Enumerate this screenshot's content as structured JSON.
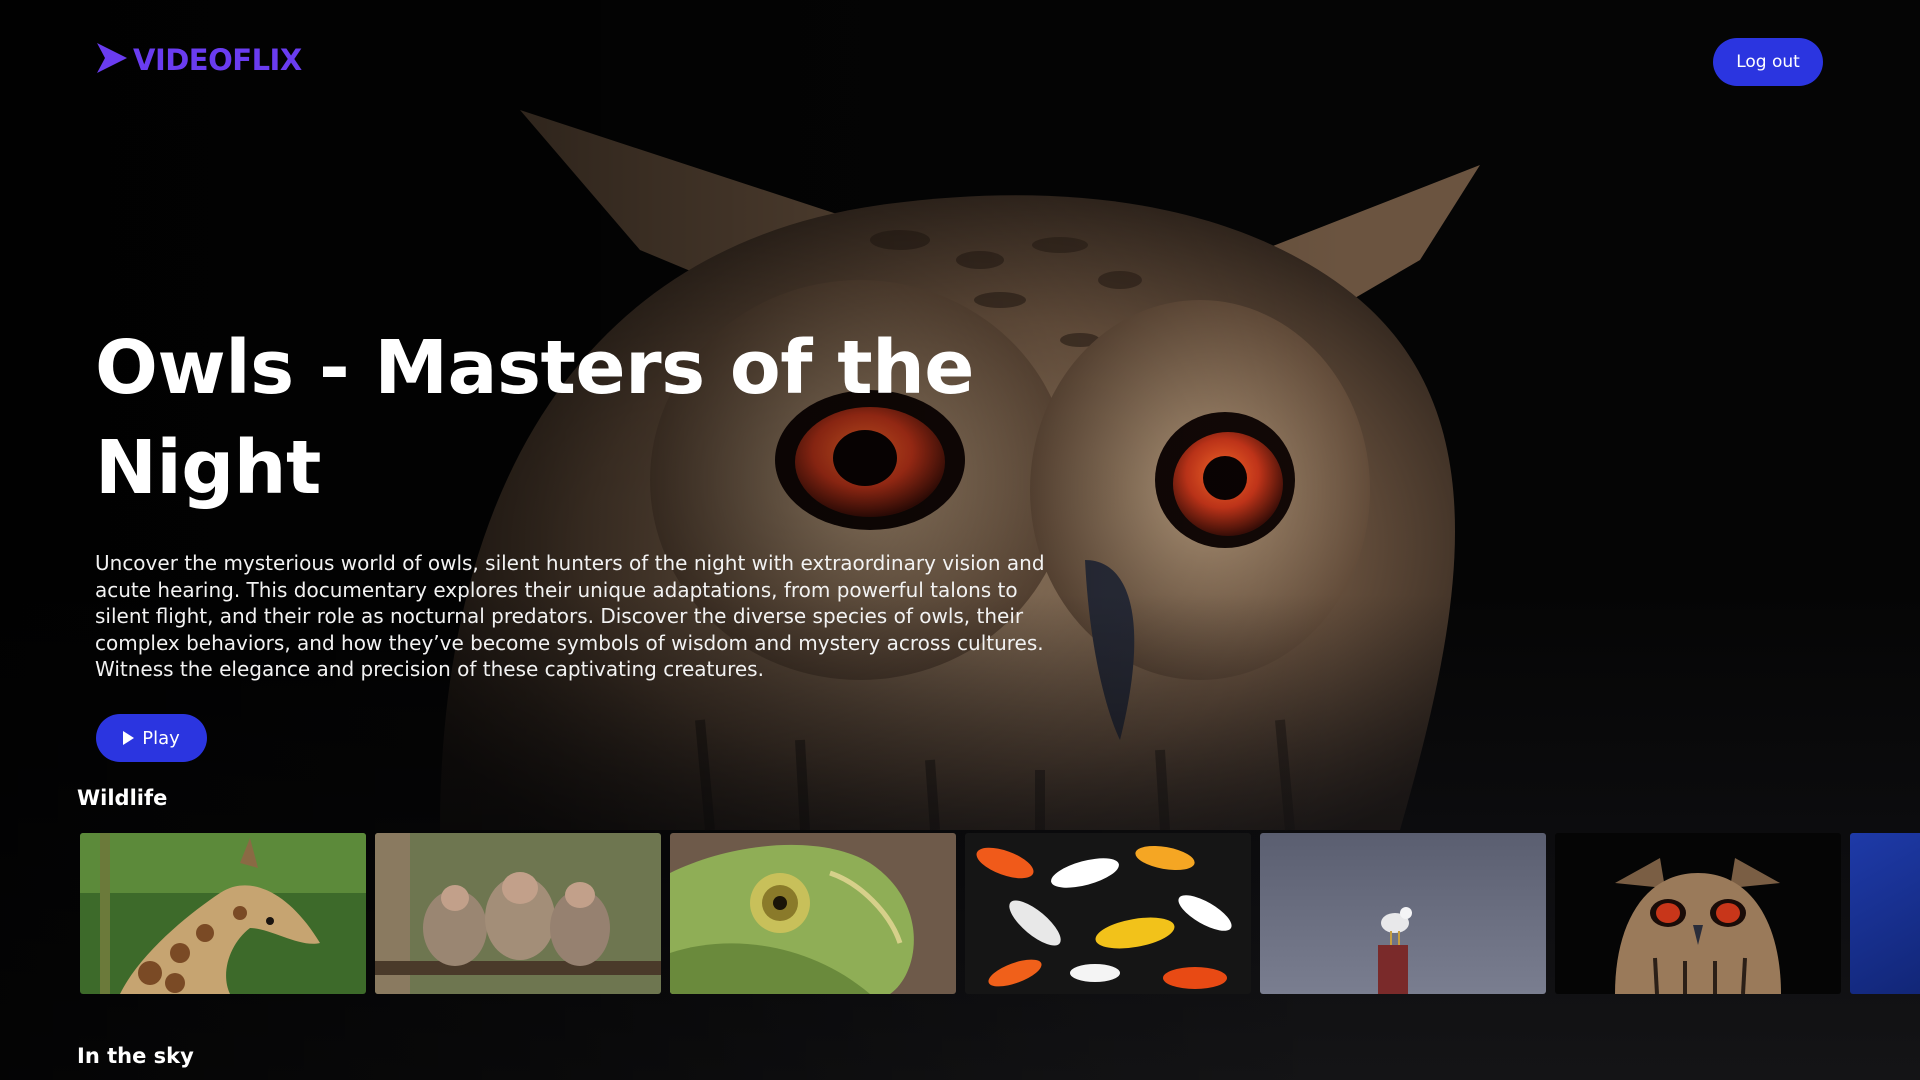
{
  "brand": {
    "name": "VIDEOFLIX",
    "color": "#6a3cf0",
    "logo_icon": "chevron-play-icon"
  },
  "header": {
    "logout_label": "Log out"
  },
  "hero": {
    "title": "Owls - Masters of the Night",
    "description": "Uncover the mysterious world of owls, silent hunters of the night with extraordinary vision and acute hearing. This documentary explores their unique adaptations, from powerful talons to silent flight, and their role as nocturnal predators. Discover the diverse species of owls, their complex behaviors, and how they’ve become symbols of wisdom and mystery across cultures. Witness the elegance and precision of these captivating creatures.",
    "play_label": "Play",
    "background_image": "owl-closeup"
  },
  "rows": [
    {
      "title": "Wildlife",
      "items": [
        {
          "image": "giraffe"
        },
        {
          "image": "baboons"
        },
        {
          "image": "chameleon"
        },
        {
          "image": "koi-fish"
        },
        {
          "image": "seagull-on-post"
        },
        {
          "image": "eagle-owl"
        },
        {
          "image": "blue-ocean"
        }
      ]
    },
    {
      "title": "In the sky"
    }
  ],
  "colors": {
    "accent": "#2b35e0",
    "background": "#0b0b0d"
  }
}
